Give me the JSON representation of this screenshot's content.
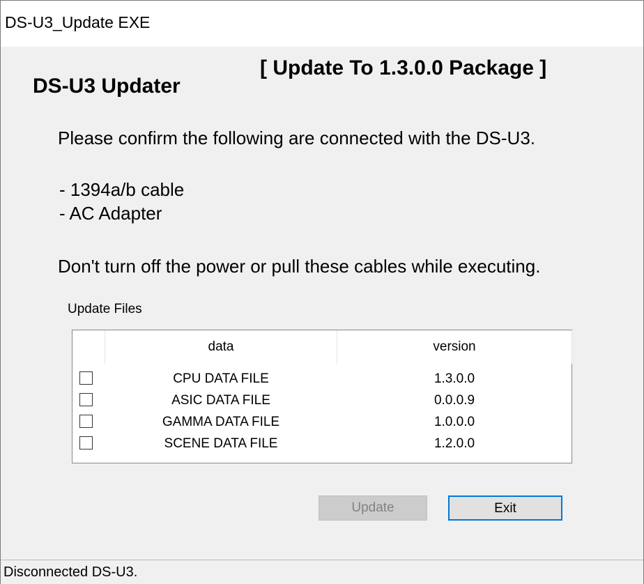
{
  "window": {
    "title": "DS-U3_Update EXE",
    "app_title": "DS-U3 Updater",
    "package_title": "[ Update To 1.3.0.0 Package ]"
  },
  "instructions": {
    "confirm": "Please confirm the following are connected with the DS-U3.",
    "items": [
      "- 1394a/b cable",
      "- AC Adapter"
    ],
    "warning": "Don't turn off the power or pull these cables while executing."
  },
  "update_files": {
    "group_label": "Update Files",
    "columns": [
      "data",
      "version"
    ],
    "rows": [
      {
        "checked": false,
        "data": "CPU DATA FILE",
        "version": "1.3.0.0"
      },
      {
        "checked": false,
        "data": "ASIC DATA FILE",
        "version": "0.0.0.9"
      },
      {
        "checked": false,
        "data": "GAMMA DATA FILE",
        "version": "1.0.0.0"
      },
      {
        "checked": false,
        "data": "SCENE DATA FILE",
        "version": "1.2.0.0"
      }
    ]
  },
  "buttons": {
    "update_label": "Update",
    "update_enabled": false,
    "exit_label": "Exit"
  },
  "status": {
    "text": "Disconnected DS-U3."
  },
  "colors": {
    "window_bg": "#f0f0f0",
    "focus_border": "#0078d7",
    "disabled_button": "#cccccc"
  }
}
